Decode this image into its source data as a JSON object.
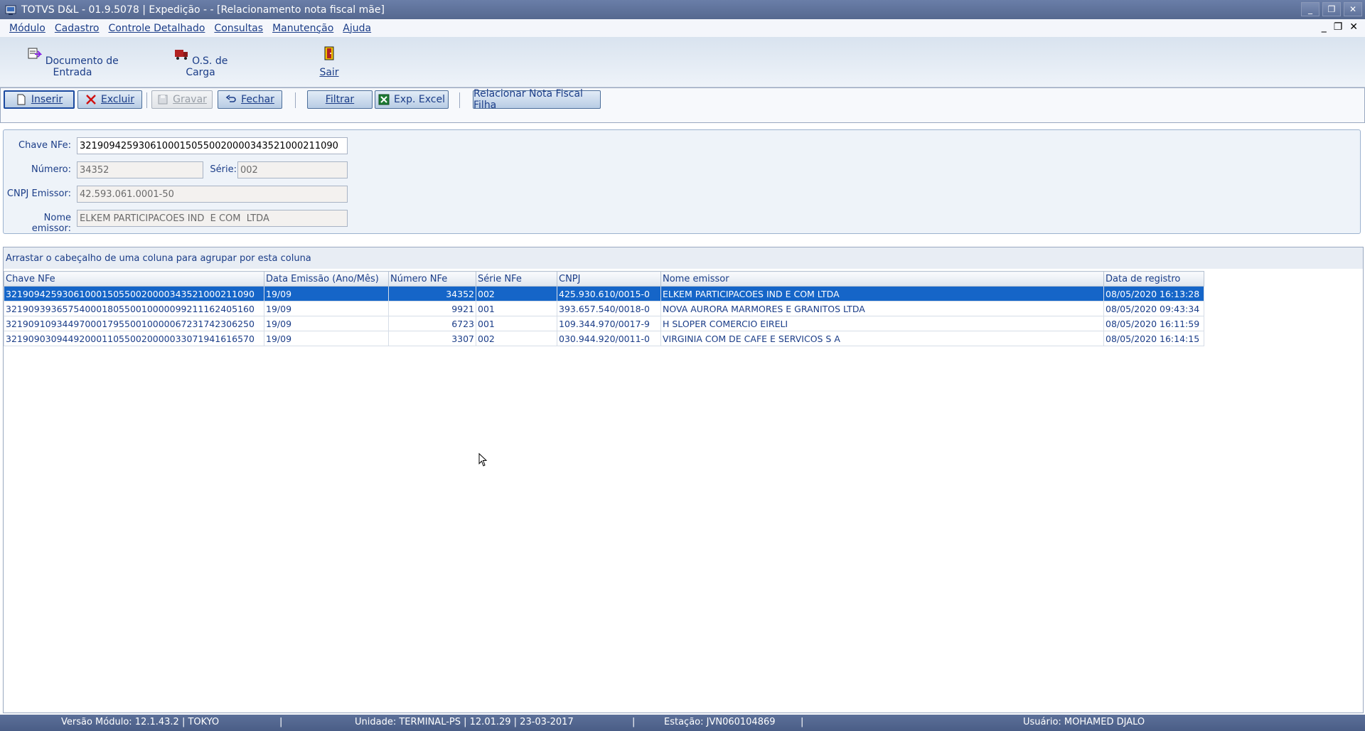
{
  "window": {
    "title": "TOTVS D&L - 01.9.5078 | Expedição - - [Relacionamento nota fiscal mãe]",
    "controls": {
      "minimize": "_",
      "restore": "❐",
      "close": "✕"
    }
  },
  "menu": {
    "items": [
      "Módulo",
      "Cadastro",
      "Controle Detalhado",
      "Consultas",
      "Manutenção",
      "Ajuda"
    ],
    "mdi_controls": [
      "_",
      "❐",
      "✕"
    ]
  },
  "big_toolbar": {
    "items": [
      {
        "label": "Documento de Entrada",
        "icon": "document-entry-icon"
      },
      {
        "label": "O.S. de Carga",
        "icon": "cargo-truck-icon"
      },
      {
        "label": "Sair",
        "icon": "exit-door-icon"
      }
    ]
  },
  "toolbar": {
    "insert": "Inserir",
    "delete": "Excluir",
    "save": "Gravar",
    "close": "Fechar",
    "filter": "Filtrar",
    "export_excel": "Exp. Excel",
    "relate_child": "Relacionar Nota Fiscal Filha"
  },
  "form": {
    "chave_label": "Chave NFe:",
    "chave_value": "32190942593061000150550020000343521000211090",
    "numero_label": "Número:",
    "numero_value": "34352",
    "serie_label": "Série:",
    "serie_value": "002",
    "cnpj_label": "CNPJ Emissor:",
    "cnpj_value": "42.593.061.0001-50",
    "nome_label": "Nome emissor:",
    "nome_value": "ELKEM PARTICIPACOES IND  E COM  LTDA"
  },
  "grid": {
    "group_hint": "Arrastar o cabeçalho de uma coluna para agrupar por esta coluna",
    "columns": [
      "Chave NFe",
      "Data Emissão (Ano/Mês)",
      "Número NFe",
      "Série NFe",
      "CNPJ",
      "Nome emissor",
      "Data de registro"
    ],
    "rows": [
      [
        "32190942593061000150550020000343521000211090",
        "19/09",
        "34352",
        "002",
        "425.930.610/0015-0",
        "ELKEM PARTICIPACOES IND  E COM  LTDA",
        "08/05/2020 16:13:28"
      ],
      [
        "32190939365754000180550010000099211162405160",
        "19/09",
        "9921",
        "001",
        "393.657.540/0018-0",
        "NOVA AURORA MARMORES E GRANITOS LTDA",
        "08/05/2020 09:43:34"
      ],
      [
        "32190910934497000179550010000067231742306250",
        "19/09",
        "6723",
        "001",
        "109.344.970/0017-9",
        "H SLOPER COMERCIO EIRELI",
        "08/05/2020 16:11:59"
      ],
      [
        "32190903094492000110550020000033071941616570",
        "19/09",
        "3307",
        "002",
        "030.944.920/0011-0",
        "VIRGINIA COM  DE CAFE E SERVICOS S A",
        "08/05/2020 16:14:15"
      ]
    ],
    "selected_row": 0
  },
  "status": {
    "versao": "Versão Módulo:  12.1.43.2  |  TOKYO",
    "sep1": "|",
    "unidade": "Unidade: TERMINAL-PS | 12.01.29 | 23-03-2017",
    "sep2": "|",
    "estacao": "Estação: JVN060104869",
    "sep3": "|",
    "usuario": "Usuário: MOHAMED DJALO"
  }
}
